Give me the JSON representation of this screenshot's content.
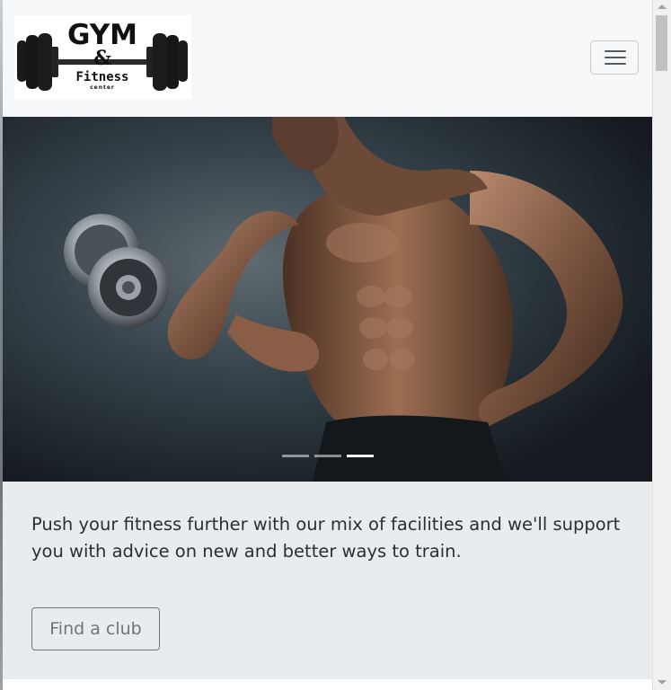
{
  "brand": {
    "logo_line1": "GYM",
    "logo_amp": "&",
    "logo_line2": "Fitness",
    "logo_line3": "center"
  },
  "navbar": {
    "toggler_icon": "hamburger-menu-icon"
  },
  "carousel": {
    "slide_count": 3,
    "active_index": 2,
    "image_description_icon": "bodybuilder-with-dumbbell-photo"
  },
  "content": {
    "lead_text": "Push your fitness further with our mix of facilities and we'll support you with advice on new and better ways to train.",
    "button_label": "Find a club"
  },
  "colors": {
    "navbar_bg": "#f5f7f9",
    "content_bg": "#e9ecef",
    "button_border": "#6c757d",
    "text": "#2b2f33"
  }
}
